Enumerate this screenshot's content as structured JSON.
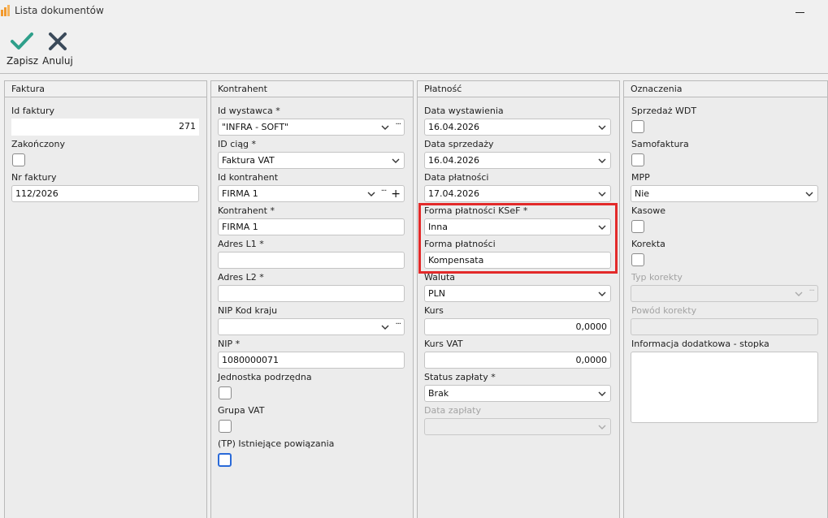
{
  "window": {
    "title": "Lista dokumentów"
  },
  "toolbar": {
    "save_label": "Zapisz",
    "cancel_label": "Anuluj"
  },
  "faktura": {
    "header": "Faktura",
    "id_label": "Id faktury",
    "id_value": "271",
    "closed_label": "Zakończony",
    "nr_label": "Nr faktury",
    "nr_value": "112/2026"
  },
  "kontrahent": {
    "header": "Kontrahent",
    "id_wystawcy_label": "Id wystawca *",
    "id_wystawcy_value": "\"INFRA - SOFT\"",
    "id_ciag_label": "ID ciąg *",
    "id_ciag_value": "Faktura VAT",
    "id_kontrahent_label": "Id kontrahent",
    "id_kontrahent_value": "FIRMA 1",
    "kontrahent_label": "Kontrahent *",
    "kontrahent_value": "FIRMA 1",
    "adres1_label": "Adres L1 *",
    "adres1_value": "",
    "adres2_label": "Adres L2 *",
    "adres2_value": "",
    "nip_kod_label": "NIP Kod kraju",
    "nip_kod_value": "",
    "nip_label": "NIP *",
    "nip_value": "1080000071",
    "jednostka_label": "Jednostka podrzędna",
    "grupa_label": "Grupa VAT",
    "powiazania_label": "(TP) Istniejące powiązania"
  },
  "platnosc": {
    "header": "Płatność",
    "data_wyst_label": "Data wystawienia",
    "data_wyst_value": "16.04.2026",
    "data_sprz_label": "Data sprzedaży",
    "data_sprz_value": "16.04.2026",
    "data_plat_label": "Data płatności",
    "data_plat_value": "17.04.2026",
    "ksef_label": "Forma płatności KSeF *",
    "ksef_value": "Inna",
    "forma_label": "Forma płatności",
    "forma_value": "Kompensata",
    "waluta_label": "Waluta",
    "waluta_value": "PLN",
    "kurs_label": "Kurs",
    "kurs_value": "0,0000",
    "kurs_vat_label": "Kurs VAT",
    "kurs_vat_value": "0,0000",
    "status_label": "Status zapłaty *",
    "status_value": "Brak",
    "data_zapl_label": "Data zapłaty",
    "data_zapl_value": ""
  },
  "oznaczenia": {
    "header": "Oznaczenia",
    "wdt_label": "Sprzedaż WDT",
    "samofaktura_label": "Samofaktura",
    "mpp_label": "MPP",
    "mpp_value": "Nie",
    "kasowe_label": "Kasowe",
    "korekta_label": "Korekta",
    "typ_korekty_label": "Typ korekty",
    "powod_label": "Powód korekty",
    "info_label": "Informacja dodatkowa - stopka"
  },
  "colors": {
    "accent_save": "#2e9f8a",
    "highlight": "#e32a2a",
    "focus": "#2a6ad8"
  }
}
